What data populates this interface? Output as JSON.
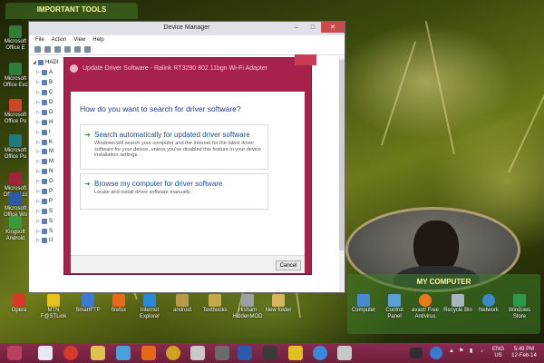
{
  "desktop": {
    "tools_panel_label": "IMPORTANT TOOLS",
    "left_icons": [
      {
        "label": "Microsoft Office E"
      },
      {
        "label": "Microsoft Office Exc"
      },
      {
        "label": "Microsoft Office Po"
      },
      {
        "label": "Microsoft Office Pu"
      },
      {
        "label": "Microsoft Office Acc"
      },
      {
        "label": "Microsoft Office Wo"
      },
      {
        "label": "Kingsoft Android"
      }
    ],
    "bottom_icons": [
      {
        "label": "Opera",
        "color": "#d83a2a"
      },
      {
        "label": "MTN F@STLink",
        "color": "#e8c21a"
      },
      {
        "label": "SmartFTP",
        "color": "#3a7bd5"
      },
      {
        "label": "firefox",
        "color": "#e66a1a"
      },
      {
        "label": "Internet Explorer",
        "color": "#2a8ad8"
      },
      {
        "label": "android",
        "color": "#b89a4a"
      },
      {
        "label": "Textbooks",
        "color": "#c9a84a"
      },
      {
        "label": "Hisham HiddenMOD",
        "color": "#9aa0a6"
      },
      {
        "label": "New folder",
        "color": "#d9b45a"
      }
    ],
    "my_computer_panel_label": "MY COMPUTER",
    "my_computer_icons": [
      {
        "label": "Computer"
      },
      {
        "label": "Control Panel"
      },
      {
        "label": "avast! Free Antivirus"
      },
      {
        "label": "Recycle Bin"
      },
      {
        "label": "Network"
      },
      {
        "label": "Windows Store"
      }
    ]
  },
  "device_manager": {
    "title": "Device Manager",
    "menu": [
      "File",
      "Action",
      "View",
      "Help"
    ],
    "tree": [
      "HADI",
      "A",
      "B",
      "C",
      "D",
      "D",
      "H",
      "I",
      "K",
      "M",
      "M",
      "N",
      "O",
      "P",
      "P",
      "S",
      "S",
      "S",
      "U"
    ]
  },
  "wizard": {
    "title": "Update Driver Software - Ralink RT3290 802.11bgn Wi-Fi Adapter",
    "question": "How do you want to search for driver software?",
    "option_auto": {
      "title": "Search automatically for updated driver software",
      "desc": "Windows will search your computer and the Internet for the latest driver software for your device, unless you've disabled this feature in your device installation settings."
    },
    "option_browse": {
      "title": "Browse my computer for driver software",
      "desc": "Locate and install driver software manually."
    },
    "cancel_label": "Cancel"
  },
  "taskbar": {
    "language": "ENG",
    "region": "US",
    "time": "5:49 PM",
    "date": "12-Feb-14",
    "accent": "#7a2445"
  }
}
